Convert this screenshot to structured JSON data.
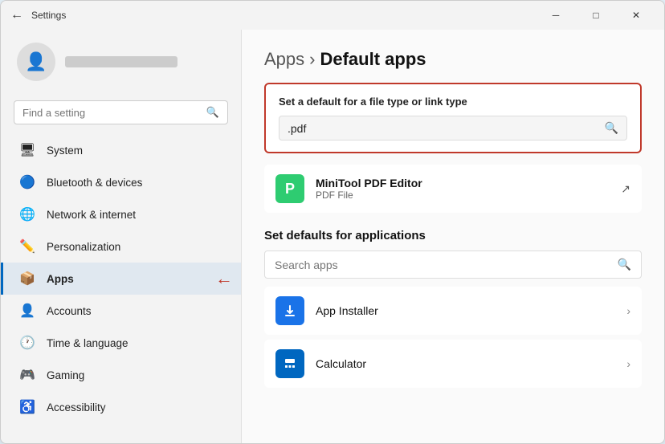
{
  "window": {
    "title": "Settings",
    "controls": {
      "minimize": "─",
      "maximize": "□",
      "close": "✕"
    }
  },
  "sidebar": {
    "search_placeholder": "Find a setting",
    "nav_items": [
      {
        "id": "system",
        "label": "System",
        "icon": "🖥",
        "active": false
      },
      {
        "id": "bluetooth",
        "label": "Bluetooth & devices",
        "icon": "🔵",
        "active": false
      },
      {
        "id": "network",
        "label": "Network & internet",
        "icon": "🌐",
        "active": false
      },
      {
        "id": "personalization",
        "label": "Personalization",
        "icon": "✏️",
        "active": false
      },
      {
        "id": "apps",
        "label": "Apps",
        "icon": "📦",
        "active": true
      },
      {
        "id": "accounts",
        "label": "Accounts",
        "icon": "👤",
        "active": false
      },
      {
        "id": "time-language",
        "label": "Time & language",
        "icon": "🕐",
        "active": false
      },
      {
        "id": "gaming",
        "label": "Gaming",
        "icon": "🎮",
        "active": false
      },
      {
        "id": "accessibility",
        "label": "Accessibility",
        "icon": "♿",
        "active": false
      }
    ]
  },
  "main": {
    "breadcrumb_parent": "Apps",
    "breadcrumb_separator": "›",
    "breadcrumb_current": "Default apps",
    "file_type_section": {
      "label": "Set a default for a file type or link type",
      "input_value": ".pdf"
    },
    "current_app": {
      "name": "MiniTool PDF Editor",
      "type": "PDF File"
    },
    "defaults_section_label": "Set defaults for applications",
    "search_apps_placeholder": "Search apps",
    "app_list": [
      {
        "id": "app-installer",
        "name": "App Installer",
        "color": "#1a73e8"
      },
      {
        "id": "calculator",
        "name": "Calculator",
        "color": "#0067c0"
      }
    ]
  }
}
